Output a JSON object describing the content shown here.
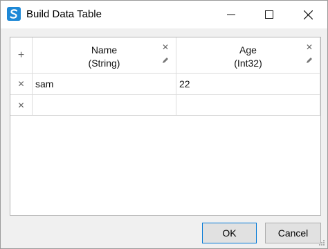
{
  "window": {
    "title": "Build Data Table",
    "controls": {
      "minimize": "minimize-icon",
      "maximize": "maximize-icon",
      "close": "close-icon"
    }
  },
  "table": {
    "add_column_glyph": "+",
    "columns": [
      {
        "name": "Name",
        "type": "(String)"
      },
      {
        "name": "Age",
        "type": "(Int32)"
      }
    ],
    "rows": [
      {
        "cells": [
          "sam",
          "22"
        ]
      },
      {
        "cells": [
          "",
          ""
        ]
      }
    ],
    "remove_glyph": "✕"
  },
  "buttons": {
    "ok": "OK",
    "cancel": "Cancel"
  },
  "colors": {
    "accent": "#0078d7",
    "app_icon": "#1e88d6"
  }
}
